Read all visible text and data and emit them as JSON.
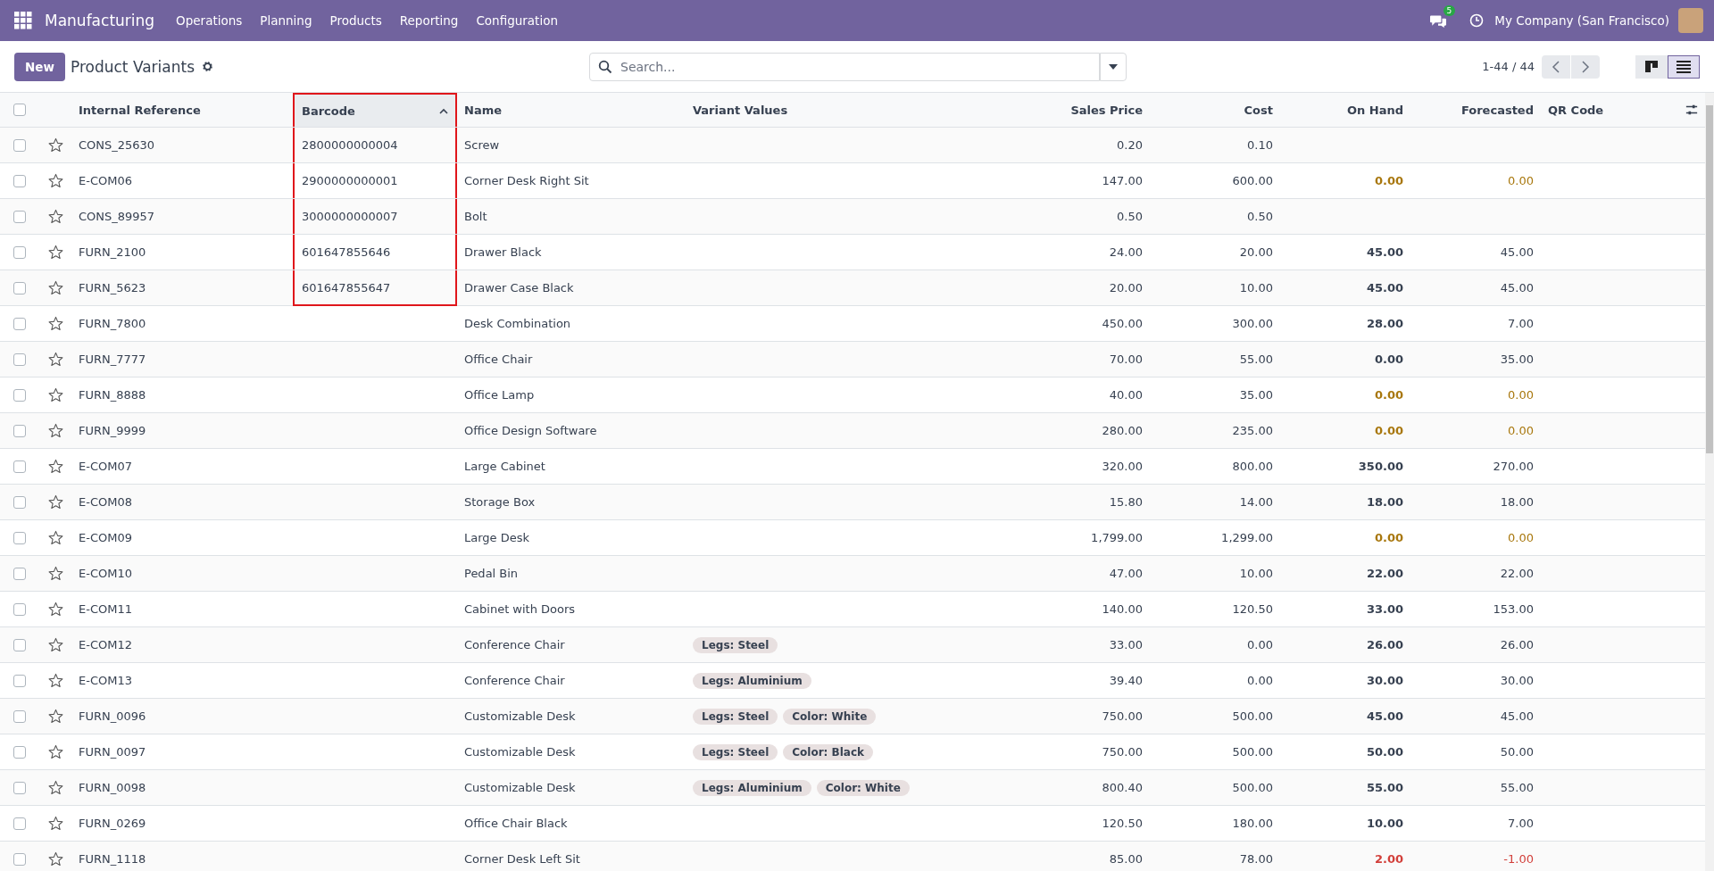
{
  "navbar": {
    "app_name": "Manufacturing",
    "menu": [
      "Operations",
      "Planning",
      "Products",
      "Reporting",
      "Configuration"
    ],
    "messages_count": "5",
    "company": "My Company (San Francisco)"
  },
  "control_panel": {
    "new_button": "New",
    "title": "Product Variants",
    "search_placeholder": "Search...",
    "pager": "1-44 / 44",
    "views": [
      {
        "kind": "kanban",
        "selected": false
      },
      {
        "kind": "list",
        "selected": true
      }
    ]
  },
  "table": {
    "columns": [
      {
        "label": "Internal Reference",
        "kind": "text",
        "sorted": false,
        "highlighted": false
      },
      {
        "label": "Barcode",
        "kind": "text",
        "sorted": true,
        "highlighted": true
      },
      {
        "label": "Name",
        "kind": "text",
        "sorted": false,
        "highlighted": false
      },
      {
        "label": "Variant Values",
        "kind": "tags",
        "sorted": false,
        "highlighted": false
      },
      {
        "label": "Sales Price",
        "kind": "number",
        "sorted": false,
        "highlighted": false
      },
      {
        "label": "Cost",
        "kind": "number",
        "sorted": false,
        "highlighted": false
      },
      {
        "label": "On Hand",
        "kind": "number",
        "sorted": false,
        "highlighted": false
      },
      {
        "label": "Forecasted",
        "kind": "number",
        "sorted": false,
        "highlighted": false
      },
      {
        "label": "QR Code",
        "kind": "text",
        "sorted": false,
        "highlighted": false
      }
    ],
    "select_all": {
      "checked": false
    },
    "rows": [
      {
        "reference": "CONS_25630",
        "barcode": "2800000000004",
        "name": "Screw",
        "variant_values": [],
        "sales_price": "0.20",
        "cost": "0.10",
        "selected": false,
        "favorite": false,
        "highlighted": true
      },
      {
        "reference": "E-COM06",
        "barcode": "2900000000001",
        "name": "Corner Desk Right Sit",
        "variant_values": [],
        "sales_price": "147.00",
        "cost": "600.00",
        "on_hand": "0.00",
        "forecasted": "0.00",
        "color": "#a8770d",
        "selected": false,
        "favorite": false,
        "highlighted": true
      },
      {
        "reference": "CONS_89957",
        "barcode": "3000000000007",
        "name": "Bolt",
        "variant_values": [],
        "sales_price": "0.50",
        "cost": "0.50",
        "selected": false,
        "favorite": false,
        "highlighted": true
      },
      {
        "reference": "FURN_2100",
        "barcode": "601647855646",
        "name": "Drawer Black",
        "variant_values": [],
        "sales_price": "24.00",
        "cost": "20.00",
        "on_hand": "45.00",
        "forecasted": "45.00",
        "color": "#374151",
        "selected": false,
        "favorite": false,
        "highlighted": true
      },
      {
        "reference": "FURN_5623",
        "barcode": "601647855647",
        "name": "Drawer Case Black",
        "variant_values": [],
        "sales_price": "20.00",
        "cost": "10.00",
        "on_hand": "45.00",
        "forecasted": "45.00",
        "color": "#374151",
        "selected": false,
        "favorite": false,
        "highlighted": true
      },
      {
        "reference": "FURN_7800",
        "name": "Desk Combination",
        "variant_values": [],
        "sales_price": "450.00",
        "cost": "300.00",
        "on_hand": "28.00",
        "forecasted": "7.00",
        "color": "#374151",
        "selected": false,
        "favorite": false
      },
      {
        "reference": "FURN_7777",
        "name": "Office Chair",
        "variant_values": [],
        "sales_price": "70.00",
        "cost": "55.00",
        "on_hand": "0.00",
        "forecasted": "35.00",
        "color": "#374151",
        "selected": false,
        "favorite": false
      },
      {
        "reference": "FURN_8888",
        "name": "Office Lamp",
        "variant_values": [],
        "sales_price": "40.00",
        "cost": "35.00",
        "on_hand": "0.00",
        "forecasted": "0.00",
        "color": "#a8770d",
        "selected": false,
        "favorite": false
      },
      {
        "reference": "FURN_9999",
        "name": "Office Design Software",
        "variant_values": [],
        "sales_price": "280.00",
        "cost": "235.00",
        "on_hand": "0.00",
        "forecasted": "0.00",
        "color": "#a8770d",
        "selected": false,
        "favorite": false
      },
      {
        "reference": "E-COM07",
        "name": "Large Cabinet",
        "variant_values": [],
        "sales_price": "320.00",
        "cost": "800.00",
        "on_hand": "350.00",
        "forecasted": "270.00",
        "color": "#374151",
        "selected": false,
        "favorite": false
      },
      {
        "reference": "E-COM08",
        "name": "Storage Box",
        "variant_values": [],
        "sales_price": "15.80",
        "cost": "14.00",
        "on_hand": "18.00",
        "forecasted": "18.00",
        "color": "#374151",
        "selected": false,
        "favorite": false
      },
      {
        "reference": "E-COM09",
        "name": "Large Desk",
        "variant_values": [],
        "sales_price": "1,799.00",
        "cost": "1,299.00",
        "on_hand": "0.00",
        "forecasted": "0.00",
        "color": "#a8770d",
        "selected": false,
        "favorite": false
      },
      {
        "reference": "E-COM10",
        "name": "Pedal Bin",
        "variant_values": [],
        "sales_price": "47.00",
        "cost": "10.00",
        "on_hand": "22.00",
        "forecasted": "22.00",
        "color": "#374151",
        "selected": false,
        "favorite": false
      },
      {
        "reference": "E-COM11",
        "name": "Cabinet with Doors",
        "variant_values": [],
        "sales_price": "140.00",
        "cost": "120.50",
        "on_hand": "33.00",
        "forecasted": "153.00",
        "color": "#374151",
        "selected": false,
        "favorite": false
      },
      {
        "reference": "E-COM12",
        "name": "Conference Chair",
        "variant_values": [
          "Legs: Steel"
        ],
        "sales_price": "33.00",
        "cost": "0.00",
        "on_hand": "26.00",
        "forecasted": "26.00",
        "color": "#374151",
        "selected": false,
        "favorite": false
      },
      {
        "reference": "E-COM13",
        "name": "Conference Chair",
        "variant_values": [
          "Legs: Aluminium"
        ],
        "sales_price": "39.40",
        "cost": "0.00",
        "on_hand": "30.00",
        "forecasted": "30.00",
        "color": "#374151",
        "selected": false,
        "favorite": false
      },
      {
        "reference": "FURN_0096",
        "name": "Customizable Desk",
        "variant_values": [
          "Legs: Steel",
          "Color: White"
        ],
        "sales_price": "750.00",
        "cost": "500.00",
        "on_hand": "45.00",
        "forecasted": "45.00",
        "color": "#374151",
        "selected": false,
        "favorite": false
      },
      {
        "reference": "FURN_0097",
        "name": "Customizable Desk",
        "variant_values": [
          "Legs: Steel",
          "Color: Black"
        ],
        "sales_price": "750.00",
        "cost": "500.00",
        "on_hand": "50.00",
        "forecasted": "50.00",
        "color": "#374151",
        "selected": false,
        "favorite": false
      },
      {
        "reference": "FURN_0098",
        "name": "Customizable Desk",
        "variant_values": [
          "Legs: Aluminium",
          "Color: White"
        ],
        "sales_price": "800.40",
        "cost": "500.00",
        "on_hand": "55.00",
        "forecasted": "55.00",
        "color": "#374151",
        "selected": false,
        "favorite": false
      },
      {
        "reference": "FURN_0269",
        "name": "Office Chair Black",
        "variant_values": [],
        "sales_price": "120.50",
        "cost": "180.00",
        "on_hand": "10.00",
        "forecasted": "7.00",
        "color": "#374151",
        "selected": false,
        "favorite": false
      },
      {
        "reference": "FURN_1118",
        "name": "Corner Desk Left Sit",
        "variant_values": [],
        "sales_price": "85.00",
        "cost": "78.00",
        "on_hand": "2.00",
        "forecasted": "-1.00",
        "color": "#d23f3a",
        "selected": false,
        "favorite": false
      }
    ]
  }
}
